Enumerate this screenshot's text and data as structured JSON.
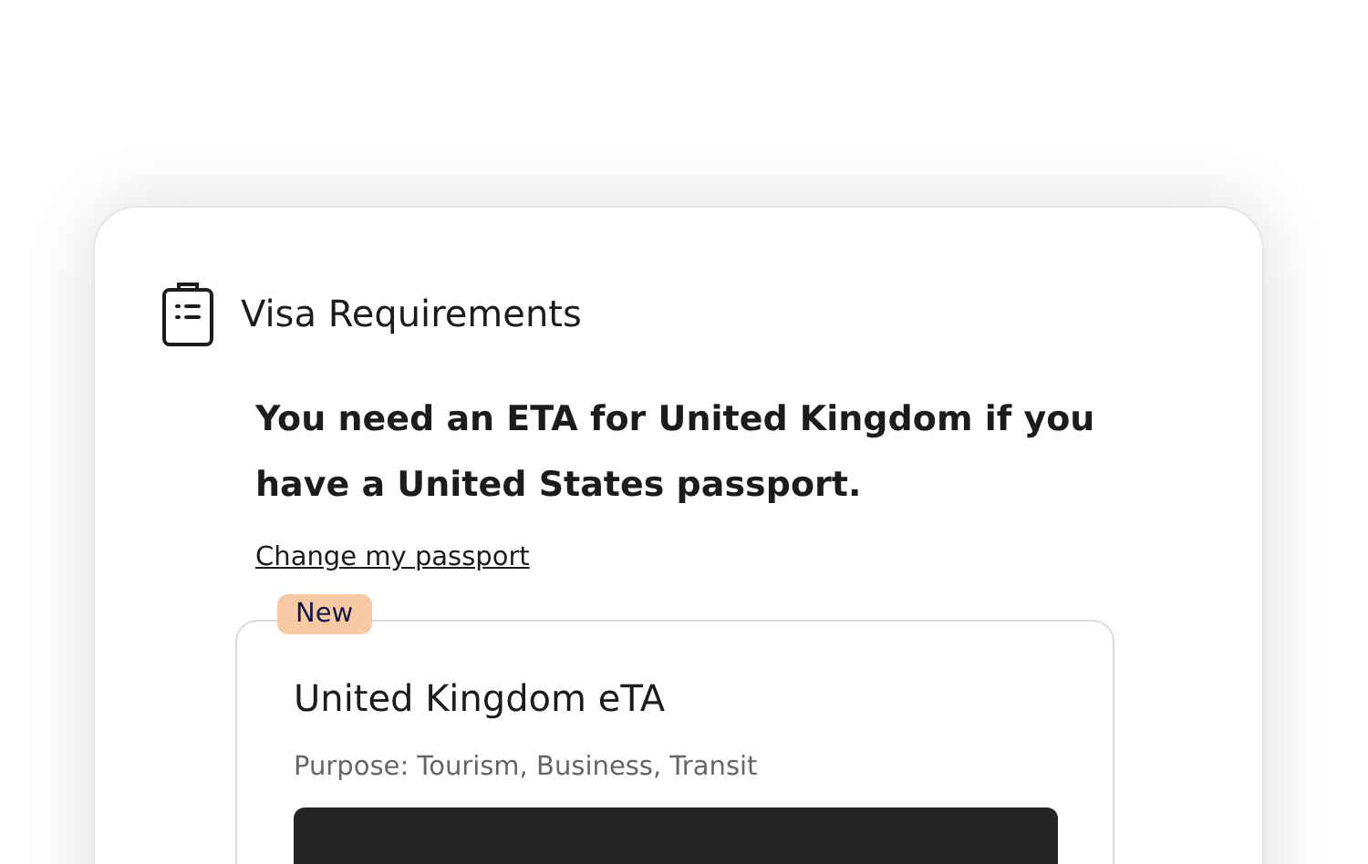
{
  "card": {
    "title": "Visa Requirements",
    "headline": "You need an ETA for United Kingdom if you have a United States passport.",
    "change_link": "Change my passport",
    "visa": {
      "badge": "New",
      "title": "United Kingdom eTA",
      "purpose": "Purpose: Tourism, Business, Transit"
    }
  }
}
